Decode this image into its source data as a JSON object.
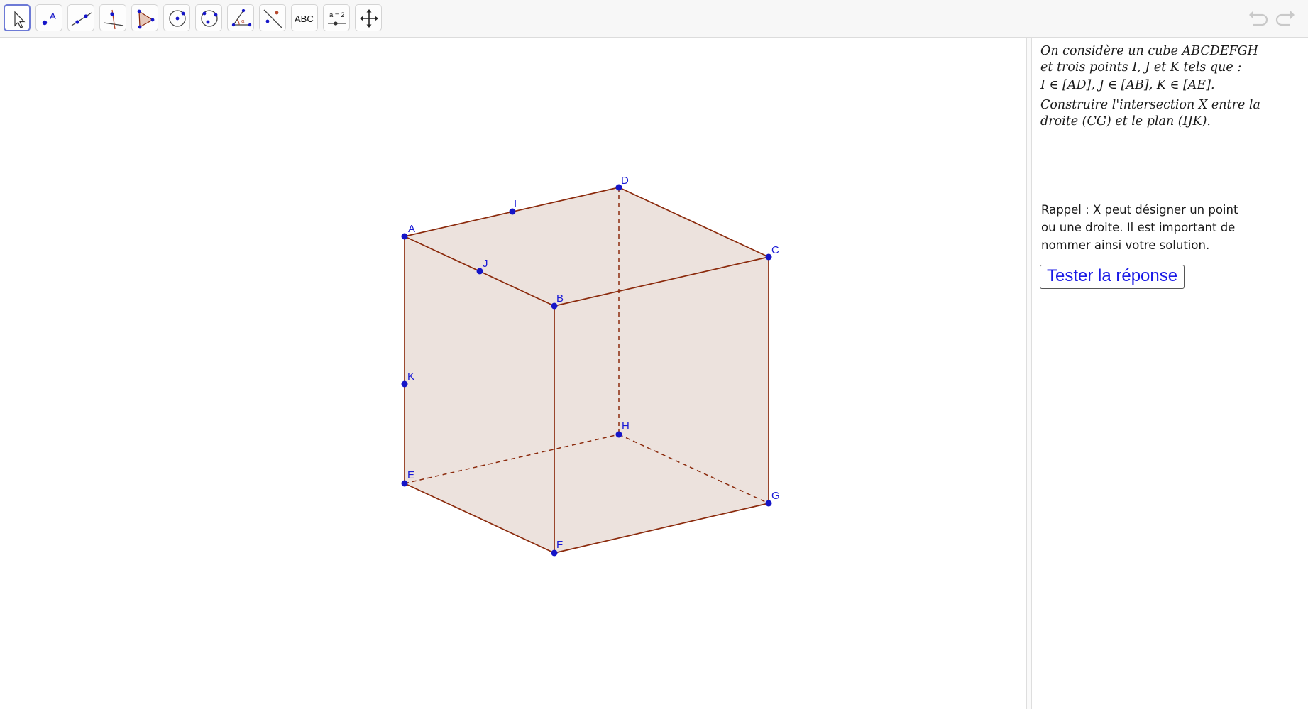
{
  "toolbar": {
    "tools": [
      {
        "name": "move-tool-icon"
      },
      {
        "name": "point-tool-icon",
        "label": "A"
      },
      {
        "name": "line-tool-icon"
      },
      {
        "name": "perpendicular-tool-icon"
      },
      {
        "name": "polygon-tool-icon"
      },
      {
        "name": "circle-tool-icon"
      },
      {
        "name": "circle-through-points-icon"
      },
      {
        "name": "angle-tool-icon"
      },
      {
        "name": "reflect-tool-icon"
      },
      {
        "name": "text-tool-icon",
        "label": "ABC"
      },
      {
        "name": "slider-tool-icon",
        "label": "a = 2"
      },
      {
        "name": "move-view-tool-icon"
      }
    ],
    "undo_icon": "undo-icon",
    "redo_icon": "redo-icon"
  },
  "figure": {
    "points": {
      "A": "A",
      "B": "B",
      "C": "C",
      "D": "D",
      "E": "E",
      "F": "F",
      "G": "G",
      "H": "H",
      "I": "I",
      "J": "J",
      "K": "K"
    },
    "colors": {
      "edge": "#8b2a0c",
      "face": "#e9ddd7",
      "point": "#1515c8",
      "label": "#1a1ad6"
    }
  },
  "panel": {
    "task_lines": [
      "On considère un cube ABCDEFGH",
      "et trois points I,  J et K tels que  :",
      "I ∈ [AD],  J ∈ [AB],  K ∈ [AE].",
      "Construire l'intersection X entre la",
      "droite (CG) et le plan (IJK)."
    ],
    "rappel_lines": [
      "Rappel  :  X peut désigner un point",
      "ou une droite. Il est important de",
      "nommer ainsi votre solution."
    ],
    "button_label": "Tester la réponse"
  }
}
